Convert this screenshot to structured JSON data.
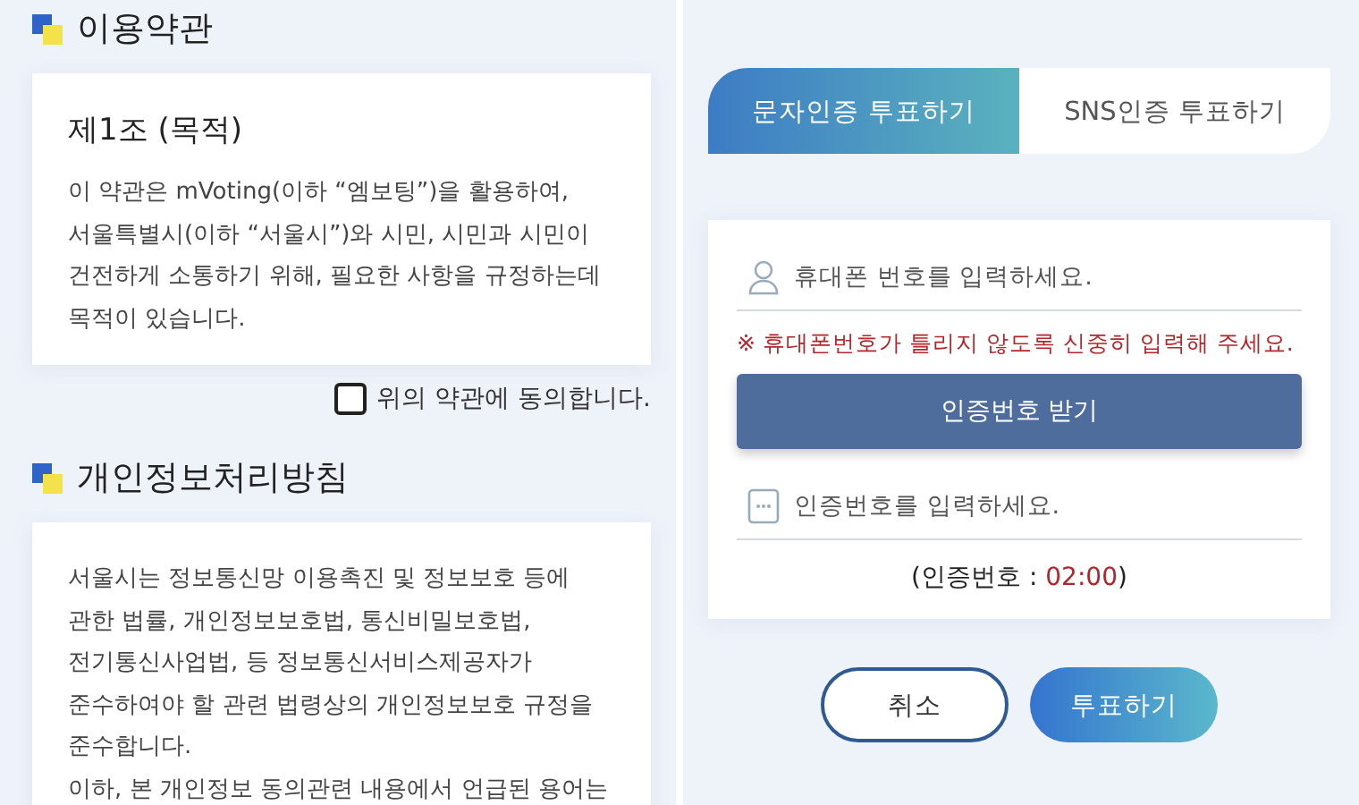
{
  "terms_panel": {
    "sections": [
      {
        "title": "이용약관",
        "heading": "제1조 (목적)",
        "lines": [
          "이 약관은 mVoting(이하 “엠보팅”)을 활용하여,",
          "서울특별시(이하 “서울시”)와 시민, 시민과 시민이",
          "건전하게 소통하기 위해, 필요한 사항을 규정하는데",
          "목적이 있습니다."
        ],
        "agree": {
          "label": "위의 약관에 동의합니다.",
          "checked": false
        }
      },
      {
        "title": "개인정보처리방침",
        "lines": [
          "서울시는 정보통신망 이용촉진 및 정보보호 등에",
          "관한 법률, 개인정보보호법, 통신비밀보호법,",
          "전기통신사업법, 등 정보통신서비스제공자가",
          "준수하여야 할 관련 법령상의 개인정보보호 규정을",
          "준수합니다.",
          "이하, 본 개인정보 동의관련 내용에서 언급된 용어는"
        ]
      }
    ]
  },
  "verify_panel": {
    "tabs": [
      {
        "label": "문자인증 투표하기",
        "selected": true
      },
      {
        "label": "SNS인증 투표하기",
        "selected": false
      }
    ],
    "phone_field": {
      "placeholder": "휴대폰 번호를 입력하세요."
    },
    "warning": "※  휴대폰번호가 틀리지 않도록 신중히 입력해 주세요.",
    "request_button": "인증번호 받기",
    "code_field": {
      "placeholder": "인증번호를 입력하세요."
    },
    "timer": {
      "label": "(인증번호 : ",
      "time": "02:00",
      "close": ")"
    },
    "buttons": [
      {
        "kind": "outline",
        "label": "취소"
      },
      {
        "kind": "primary",
        "label": "투표하기"
      }
    ]
  }
}
